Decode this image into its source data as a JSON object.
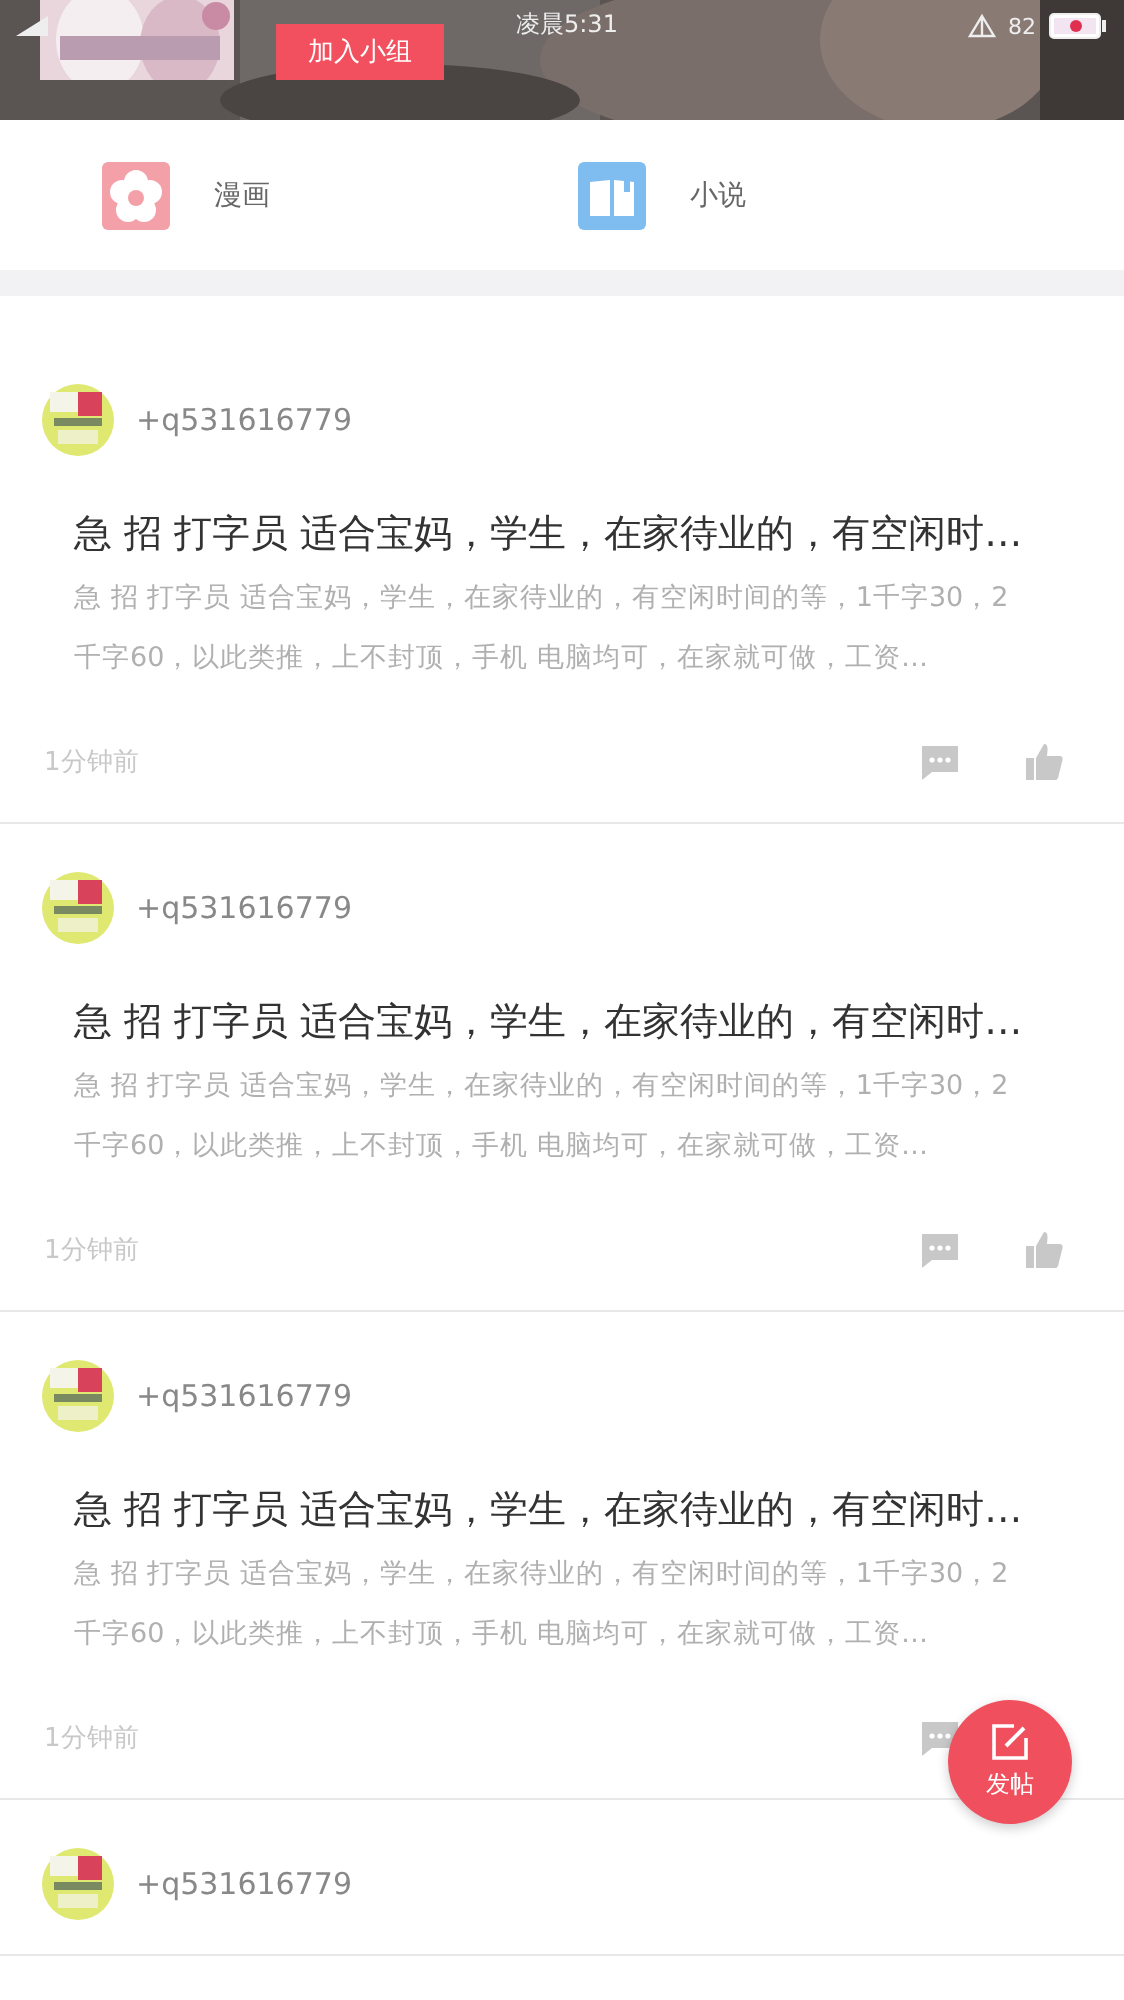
{
  "status_bar": {
    "time": "凌晨5:31",
    "battery": "82"
  },
  "header": {
    "join_button": "加入小组"
  },
  "categories": [
    {
      "label": "漫画",
      "kind": "comic"
    },
    {
      "label": "小说",
      "kind": "novel"
    }
  ],
  "posts": [
    {
      "user": "+q531616779",
      "title": "急 招 打字员 适合宝妈，学生，在家待业的，有空闲时…",
      "body": "急 招 打字员 适合宝妈，学生，在家待业的，有空闲时间的等，1千字30，2千字60，以此类推，上不封顶，手机 电脑均可，在家就可做，工资…",
      "time": "1分钟前"
    },
    {
      "user": "+q531616779",
      "title": "急 招 打字员 适合宝妈，学生，在家待业的，有空闲时…",
      "body": "急 招 打字员 适合宝妈，学生，在家待业的，有空闲时间的等，1千字30，2千字60，以此类推，上不封顶，手机 电脑均可，在家就可做，工资…",
      "time": "1分钟前"
    },
    {
      "user": "+q531616779",
      "title": "急 招 打字员 适合宝妈，学生，在家待业的，有空闲时…",
      "body": "急 招 打字员 适合宝妈，学生，在家待业的，有空闲时间的等，1千字30，2千字60，以此类推，上不封顶，手机 电脑均可，在家就可做，工资…",
      "time": "1分钟前"
    },
    {
      "user": "+q531616779"
    }
  ],
  "fab": {
    "label": "发帖"
  }
}
